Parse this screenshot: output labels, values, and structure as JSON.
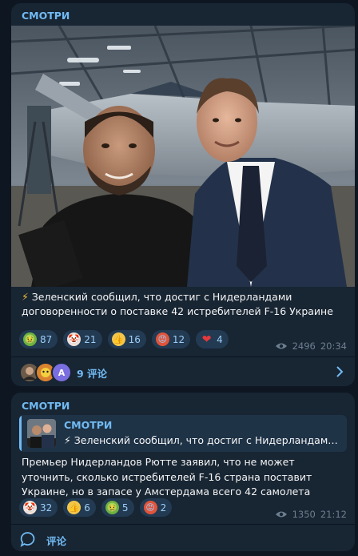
{
  "post1": {
    "channel": "СМОТРИ",
    "caption_emoji": "⚡",
    "caption": "Зеленский сообщил, что достиг с Нидерландами договоренности о поставке 42 истребителей F-16 Украине",
    "reactions": [
      {
        "icon": "nauseated-face-emoji",
        "glyph": "🤢",
        "count": "87"
      },
      {
        "icon": "clown-face-emoji",
        "glyph": "🤡",
        "count": "21"
      },
      {
        "icon": "thumbs-up-emoji",
        "glyph": "👍",
        "count": "16"
      },
      {
        "icon": "pouting-face-emoji",
        "glyph": "😡",
        "count": "12"
      },
      {
        "icon": "red-heart-emoji",
        "glyph": "❤",
        "count": "4"
      }
    ],
    "views": "2496",
    "time": "20:34",
    "comments": "9 评论",
    "comment_avatar_letter": "A"
  },
  "post2": {
    "channel": "СМОТРИ",
    "quote_title": "СМОТРИ",
    "quote_text": "⚡ Зеленский сообщил, что достиг с Нидерландами до...",
    "text": "Премьер Нидерландов Рютте заявил, что не может уточнить, сколько истребителей F-16 страна поставит Украине, но в запасе у Амстердама всего 42 самолета",
    "reactions": [
      {
        "icon": "clown-face-emoji",
        "glyph": "🤡",
        "count": "32"
      },
      {
        "icon": "thumbs-up-emoji",
        "glyph": "👍",
        "count": "6"
      },
      {
        "icon": "nauseated-face-emoji",
        "glyph": "🤢",
        "count": "5"
      },
      {
        "icon": "pouting-face-emoji",
        "glyph": "😡",
        "count": "2"
      }
    ],
    "views": "1350",
    "time": "21:12",
    "comments": "评论"
  },
  "colors": {
    "background": "#0e1621",
    "bubble": "#182533",
    "accent": "#71baf2",
    "reaction_bg": "#223a52",
    "meta": "#6d7f8f"
  }
}
